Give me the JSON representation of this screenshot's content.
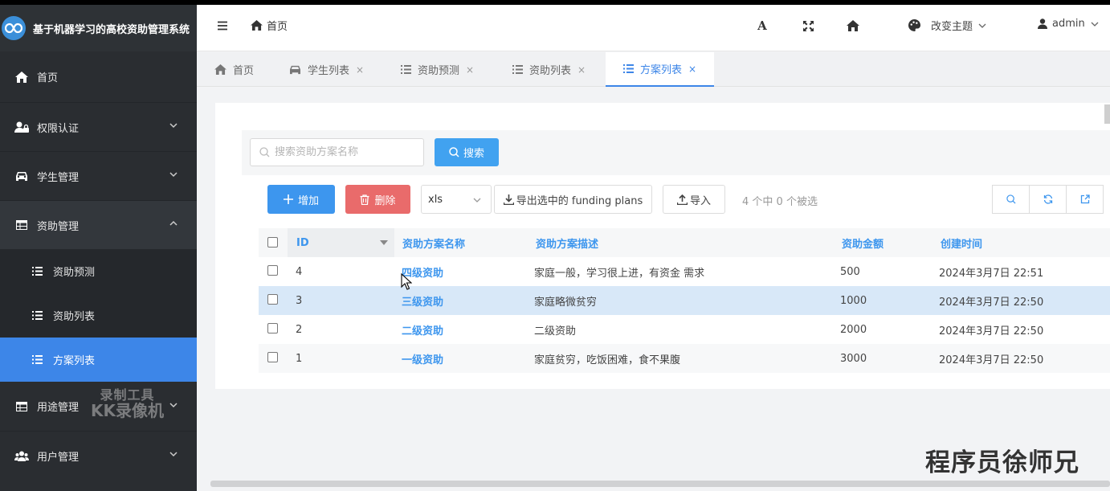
{
  "app": {
    "title": "基于机器学习的高校资助管理系统"
  },
  "sidebar": {
    "items": [
      {
        "label": "首页",
        "icon": "home-icon"
      },
      {
        "label": "权限认证",
        "icon": "user-lock-icon"
      },
      {
        "label": "学生管理",
        "icon": "car-icon"
      },
      {
        "label": "资助管理",
        "icon": "table-icon"
      },
      {
        "label": "用途管理",
        "icon": "table-icon"
      },
      {
        "label": "用户管理",
        "icon": "users-icon"
      }
    ],
    "subitems": [
      {
        "label": "资助预测"
      },
      {
        "label": "资助列表"
      },
      {
        "label": "方案列表"
      }
    ]
  },
  "header": {
    "breadcrumb": "首页",
    "font_icon_label": "A",
    "theme_label": "改变主题",
    "user_label": "admin"
  },
  "tabs": [
    {
      "label": "首页",
      "close": ""
    },
    {
      "label": "学生列表",
      "close": "×"
    },
    {
      "label": "资助预测",
      "close": "×"
    },
    {
      "label": "资助列表",
      "close": "×"
    },
    {
      "label": "方案列表",
      "close": "×"
    }
  ],
  "toolbar": {
    "search_placeholder": "搜索资助方案名称",
    "search_label": "搜索",
    "add_label": "增加",
    "delete_label": "删除",
    "export_format": "xls",
    "export_label": "导出选中的 funding plans",
    "import_label": "导入",
    "selection_count": "4 个中 0 个被选"
  },
  "table": {
    "headers": {
      "id": "ID",
      "name": "资助方案名称",
      "desc": "资助方案描述",
      "amount": "资助金额",
      "created": "创建时间"
    },
    "rows": [
      {
        "id": "4",
        "name": "四级资助",
        "desc": "家庭一般，学习很上进，有资金 需求",
        "amount": "500",
        "created": "2024年3月7日 22:51"
      },
      {
        "id": "3",
        "name": "三级资助",
        "desc": "家庭略微贫穷",
        "amount": "1000",
        "created": "2024年3月7日 22:50"
      },
      {
        "id": "2",
        "name": "二级资助",
        "desc": "二级资助",
        "amount": "2000",
        "created": "2024年3月7日 22:50"
      },
      {
        "id": "1",
        "name": "一级资助",
        "desc": "家庭贫穷，吃饭困难，食不果腹",
        "amount": "3000",
        "created": "2024年3月7日 22:50"
      }
    ]
  },
  "watermarks": {
    "recorder_line1": "录制工具",
    "recorder_line2": "KK录像机",
    "author": "程序员徐师兄"
  },
  "colors": {
    "sidebar_bg": "#2a2d31",
    "accent": "#3d86e8",
    "danger": "#e96b6b",
    "link": "#3d96ee"
  }
}
